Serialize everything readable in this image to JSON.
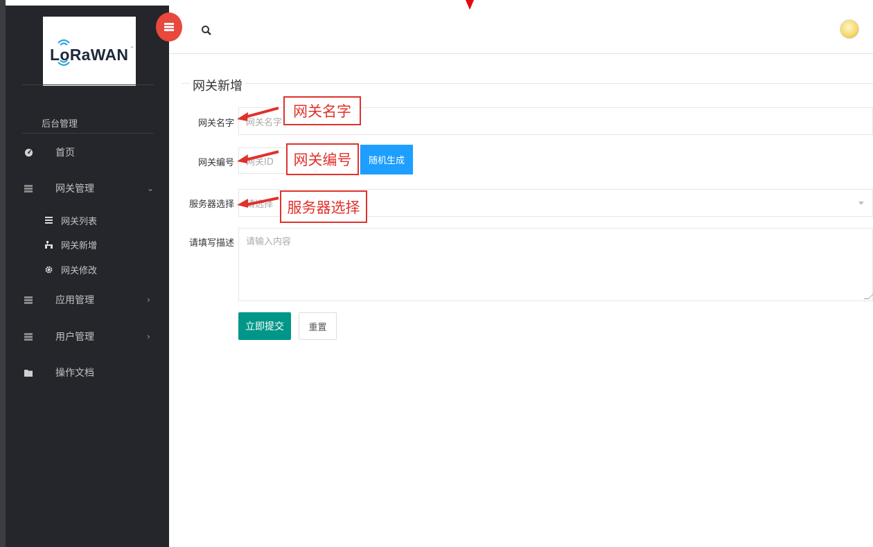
{
  "sidebar": {
    "logo_text": "LoRaWAN",
    "logo_tm": "™",
    "section_title": "后台管理",
    "items": [
      {
        "label": "首页",
        "icon": "dashboard-icon"
      },
      {
        "label": "网关管理",
        "icon": "server-icon",
        "arrow": "⌄"
      },
      {
        "label": "应用管理",
        "icon": "server-icon",
        "arrow": "›"
      },
      {
        "label": "用户管理",
        "icon": "server-icon",
        "arrow": "›"
      },
      {
        "label": "操作文档",
        "icon": "folder-icon"
      }
    ],
    "subitems": [
      {
        "label": "网关列表",
        "icon": "list-icon"
      },
      {
        "label": "网关新增",
        "icon": "sitemap-icon"
      },
      {
        "label": "网关修改",
        "icon": "gear-icon"
      }
    ]
  },
  "header": {
    "search_icon": "search-icon",
    "avatar_icon": "user-avatar"
  },
  "form": {
    "legend": "网关新增",
    "name_label": "网关名字",
    "name_placeholder": "网关名字",
    "id_label": "网关编号",
    "id_placeholder": "网关ID",
    "random_button": "随机生成",
    "server_label": "服务器选择",
    "server_placeholder": "请选择",
    "desc_label": "请填写描述",
    "desc_placeholder": "请输入内容",
    "submit_button": "立即提交",
    "reset_button": "重置"
  },
  "annotations": {
    "name": "网关名字",
    "id": "网关编号",
    "server": "服务器选择"
  },
  "colors": {
    "sidebar_bg": "#24262b",
    "accent_red": "#e8493c",
    "submit_green": "#009688",
    "button_blue": "#1e9fff",
    "callout_red": "#e0312b"
  }
}
